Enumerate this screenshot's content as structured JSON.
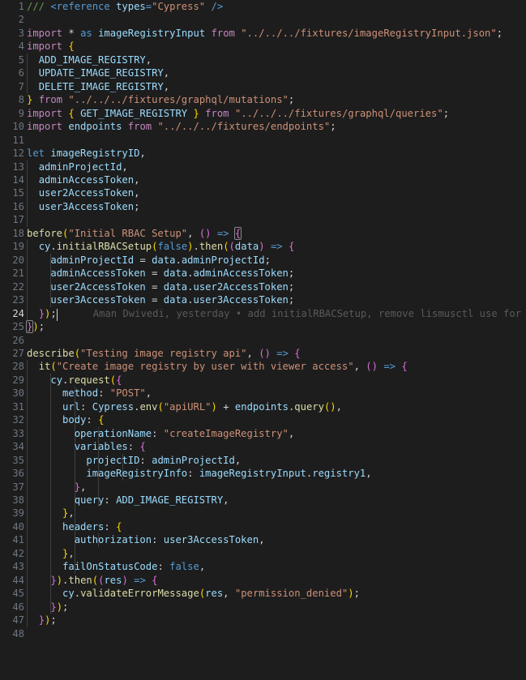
{
  "editor": {
    "theme": "vscode-dark-plus",
    "language": "typescript",
    "background_color": "#1d1d1d",
    "foreground_color": "#d4d4d4",
    "line_number_color": "#6e7681",
    "active_line_number_color": "#d7d7d7",
    "total_visible_lines": 48,
    "active_line": 24,
    "cursor_line": 24,
    "cursor_column": 8
  },
  "blame": {
    "author": "Aman Dwivedi",
    "when": "yesterday",
    "separator": "•",
    "message": "add initialRBACSetup, remove lismusctl use for ap…",
    "full_text": "Aman Dwivedi, yesterday • add initialRBACSetup, remove lismusctl use for ap…",
    "on_line": 24
  },
  "lines": [
    {
      "n": 1,
      "text": "/// <reference types=\"Cypress\" />"
    },
    {
      "n": 2,
      "text": ""
    },
    {
      "n": 3,
      "text": "import * as imageRegistryInput from \"../../../fixtures/imageRegistryInput.json\";"
    },
    {
      "n": 4,
      "text": "import {"
    },
    {
      "n": 5,
      "text": "  ADD_IMAGE_REGISTRY,"
    },
    {
      "n": 6,
      "text": "  UPDATE_IMAGE_REGISTRY,"
    },
    {
      "n": 7,
      "text": "  DELETE_IMAGE_REGISTRY,"
    },
    {
      "n": 8,
      "text": "} from \"../../../fixtures/graphql/mutations\";"
    },
    {
      "n": 9,
      "text": "import { GET_IMAGE_REGISTRY } from \"../../../fixtures/graphql/queries\";"
    },
    {
      "n": 10,
      "text": "import endpoints from \"../../../fixtures/endpoints\";"
    },
    {
      "n": 11,
      "text": ""
    },
    {
      "n": 12,
      "text": "let imageRegistryID,"
    },
    {
      "n": 13,
      "text": "  adminProjectId,"
    },
    {
      "n": 14,
      "text": "  adminAccessToken,"
    },
    {
      "n": 15,
      "text": "  user2AccessToken,"
    },
    {
      "n": 16,
      "text": "  user3AccessToken;"
    },
    {
      "n": 17,
      "text": ""
    },
    {
      "n": 18,
      "text": "before(\"Initial RBAC Setup\", () => {"
    },
    {
      "n": 19,
      "text": "  cy.initialRBACSetup(false).then((data) => {"
    },
    {
      "n": 20,
      "text": "    adminProjectId = data.adminProjectId;"
    },
    {
      "n": 21,
      "text": "    adminAccessToken = data.adminAccessToken;"
    },
    {
      "n": 22,
      "text": "    user2AccessToken = data.user2AccessToken;"
    },
    {
      "n": 23,
      "text": "    user3AccessToken = data.user3AccessToken;"
    },
    {
      "n": 24,
      "text": "  });"
    },
    {
      "n": 25,
      "text": "});"
    },
    {
      "n": 26,
      "text": ""
    },
    {
      "n": 27,
      "text": "describe(\"Testing image registry api\", () => {"
    },
    {
      "n": 28,
      "text": "  it(\"Create image registry by user with viewer access\", () => {"
    },
    {
      "n": 29,
      "text": "    cy.request({"
    },
    {
      "n": 30,
      "text": "      method: \"POST\","
    },
    {
      "n": 31,
      "text": "      url: Cypress.env(\"apiURL\") + endpoints.query(),"
    },
    {
      "n": 32,
      "text": "      body: {"
    },
    {
      "n": 33,
      "text": "        operationName: \"createImageRegistry\","
    },
    {
      "n": 34,
      "text": "        variables: {"
    },
    {
      "n": 35,
      "text": "          projectID: adminProjectId,"
    },
    {
      "n": 36,
      "text": "          imageRegistryInfo: imageRegistryInput.registry1,"
    },
    {
      "n": 37,
      "text": "        },"
    },
    {
      "n": 38,
      "text": "        query: ADD_IMAGE_REGISTRY,"
    },
    {
      "n": 39,
      "text": "      },"
    },
    {
      "n": 40,
      "text": "      headers: {"
    },
    {
      "n": 41,
      "text": "        authorization: user3AccessToken,"
    },
    {
      "n": 42,
      "text": "      },"
    },
    {
      "n": 43,
      "text": "      failOnStatusCode: false,"
    },
    {
      "n": 44,
      "text": "    }).then((res) => {"
    },
    {
      "n": 45,
      "text": "      cy.validateErrorMessage(res, \"permission_denied\");"
    },
    {
      "n": 46,
      "text": "    });"
    },
    {
      "n": 47,
      "text": "  });"
    },
    {
      "n": 48,
      "text": ""
    }
  ],
  "tokens": {
    "keywords_control": [
      "import",
      "from"
    ],
    "keywords": [
      "let",
      "as",
      "false"
    ],
    "functions": [
      "before",
      "initialRBACSetup",
      "then",
      "describe",
      "it",
      "request",
      "env",
      "query",
      "validateErrorMessage"
    ],
    "constants": [
      "ADD_IMAGE_REGISTRY",
      "UPDATE_IMAGE_REGISTRY",
      "DELETE_IMAGE_REGISTRY",
      "GET_IMAGE_REGISTRY"
    ],
    "strings": [
      "\"Cypress\"",
      "\"../../../fixtures/imageRegistryInput.json\"",
      "\"../../../fixtures/graphql/mutations\"",
      "\"../../../fixtures/graphql/queries\"",
      "\"../../../fixtures/endpoints\"",
      "\"Initial RBAC Setup\"",
      "\"Testing image registry api\"",
      "\"Create image registry by user with viewer access\"",
      "\"POST\"",
      "\"apiURL\"",
      "\"createImageRegistry\"",
      "\"permission_denied\""
    ]
  },
  "colors": {
    "background": "#1d1d1d",
    "foreground": "#d4d4d4",
    "comment": "#6a9955",
    "keyword_control": "#c586c0",
    "keyword": "#569cd6",
    "function": "#dcdcaa",
    "variable": "#9cdcfe",
    "string": "#ce9178",
    "bracket_level_1": "#ffd700",
    "bracket_level_2": "#da70d6",
    "bracket_level_3": "#179fff",
    "indent_guide": "#404040",
    "blame_text": "#5a5a5a",
    "cursor": "#d4d4d4"
  }
}
